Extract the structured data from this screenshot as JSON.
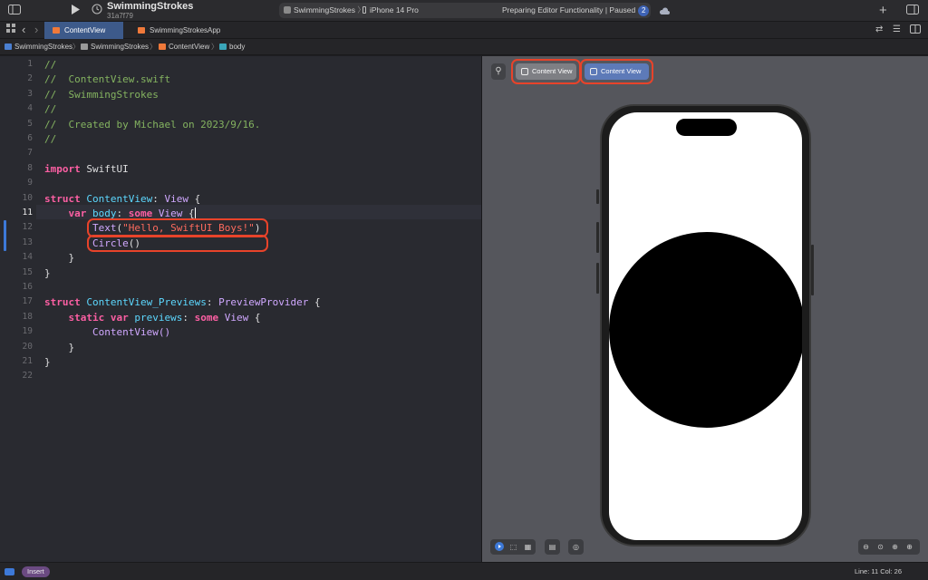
{
  "toolbar": {
    "project_name": "SwimmingStrokes",
    "commit": "31a7f79",
    "scheme_target": "SwimmingStrokes",
    "device": "iPhone 14 Pro",
    "status_text": "Preparing Editor Functionality | Paused",
    "status_badge": "2",
    "add_icon": "+"
  },
  "tabs": [
    {
      "label": "ContentView",
      "active": true
    },
    {
      "label": "SwimmingStrokesApp",
      "active": false
    }
  ],
  "breadcrumb": [
    "SwimmingStrokes",
    "SwimmingStrokes",
    "ContentView",
    "body"
  ],
  "editor": {
    "line_numbers": [
      "1",
      "2",
      "3",
      "4",
      "5",
      "6",
      "7",
      "8",
      "9",
      "10",
      "11",
      "12",
      "13",
      "14",
      "15",
      "16",
      "17",
      "18",
      "19",
      "20",
      "21",
      "22"
    ],
    "current_line": "11",
    "lines": {
      "l1": "//",
      "l2": "//  ContentView.swift",
      "l3": "//  SwimmingStrokes",
      "l4": "//",
      "l5": "//  Created by Michael on 2023/9/16.",
      "l6": "//",
      "l8_kw": "import",
      "l8_rest": " SwiftUI",
      "l10_kw": "struct",
      "l10_name": "ContentView",
      "l10_colon": ": ",
      "l10_type": "View",
      "l10_brace": " {",
      "l11_kw": "var",
      "l11_name": "body",
      "l11_colon": ": ",
      "l11_some": "some",
      "l11_type": " View",
      "l11_brace": " {",
      "l12_fn": "Text",
      "l12_open": "(",
      "l12_str": "\"Hello, SwiftUI Boys!\"",
      "l12_close": ")",
      "l13_fn": "Circle",
      "l13_paren": "()",
      "l14": "}",
      "l15": "}",
      "l17_kw": "struct",
      "l17_name": "ContentView_Previews",
      "l17_colon": ": ",
      "l17_type": "PreviewProvider",
      "l17_brace": " {",
      "l18_static": "static",
      "l18_var": "var",
      "l18_name": "previews",
      "l18_colon": ": ",
      "l18_some": "some",
      "l18_type": " View",
      "l18_brace": " {",
      "l19": "ContentView()",
      "l20": "}",
      "l21": "}"
    }
  },
  "canvas": {
    "preview_buttons": [
      "Content View",
      "Content View"
    ],
    "pin_icon": "pin-icon"
  },
  "statusbar": {
    "mode": "Insert",
    "position": "Line: 11  Col: 26"
  },
  "colors": {
    "accent": "#3d79d8",
    "highlight_box": "#e8432a",
    "keyword": "#fc5fa3",
    "string": "#fc6a5d",
    "comment": "#84b360",
    "type": "#d0a8ff"
  }
}
